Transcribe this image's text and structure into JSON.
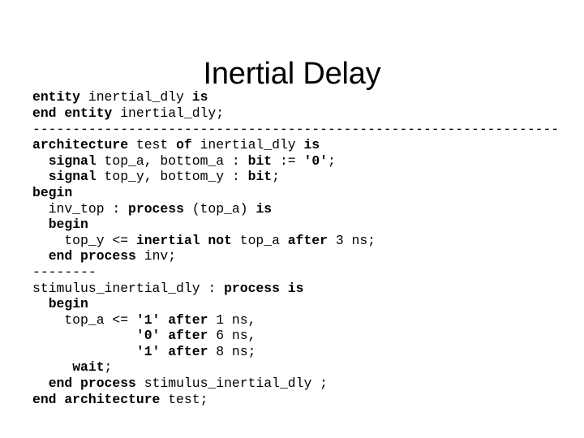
{
  "slide": {
    "title": "Inertial Delay",
    "background_color": "#ffffff",
    "text_color": "#000000"
  },
  "code": {
    "language": "VHDL",
    "lines": [
      [
        {
          "t": "entity ",
          "b": true
        },
        {
          "t": "inertial_dly ",
          "b": false
        },
        {
          "t": "is",
          "b": true
        }
      ],
      [
        {
          "t": "end entity ",
          "b": true
        },
        {
          "t": "inertial_dly;",
          "b": false
        }
      ],
      [
        {
          "t": "------------------------------------------------------------------",
          "b": false
        }
      ],
      [
        {
          "t": "architecture ",
          "b": true
        },
        {
          "t": "test ",
          "b": false
        },
        {
          "t": "of ",
          "b": true
        },
        {
          "t": "inertial_dly ",
          "b": false
        },
        {
          "t": "is",
          "b": true
        }
      ],
      [
        {
          "t": "  ",
          "b": false
        },
        {
          "t": "signal ",
          "b": true
        },
        {
          "t": "top_a, bottom_a : ",
          "b": false
        },
        {
          "t": "bit",
          "b": true
        },
        {
          "t": " := ",
          "b": false
        },
        {
          "t": "'0'",
          "b": true
        },
        {
          "t": ";",
          "b": false
        }
      ],
      [
        {
          "t": "  ",
          "b": false
        },
        {
          "t": "signal ",
          "b": true
        },
        {
          "t": "top_y, bottom_y : ",
          "b": false
        },
        {
          "t": "bit",
          "b": true
        },
        {
          "t": ";",
          "b": false
        }
      ],
      [
        {
          "t": "begin",
          "b": true
        }
      ],
      [
        {
          "t": "  inv_top : ",
          "b": false
        },
        {
          "t": "process ",
          "b": true
        },
        {
          "t": "(top_a) ",
          "b": false
        },
        {
          "t": "is",
          "b": true
        }
      ],
      [
        {
          "t": "  ",
          "b": false
        },
        {
          "t": "begin",
          "b": true
        }
      ],
      [
        {
          "t": "    top_y <= ",
          "b": false
        },
        {
          "t": "inertial not ",
          "b": true
        },
        {
          "t": "top_a ",
          "b": false
        },
        {
          "t": "after ",
          "b": true
        },
        {
          "t": "3 ns;",
          "b": false
        }
      ],
      [
        {
          "t": "  ",
          "b": false
        },
        {
          "t": "end process ",
          "b": true
        },
        {
          "t": "inv;",
          "b": false
        }
      ],
      [
        {
          "t": "--------",
          "b": false
        }
      ],
      [
        {
          "t": "stimulus_inertial_dly : ",
          "b": false
        },
        {
          "t": "process is",
          "b": true
        }
      ],
      [
        {
          "t": "  ",
          "b": false
        },
        {
          "t": "begin",
          "b": true
        }
      ],
      [
        {
          "t": "    top_a <= ",
          "b": false
        },
        {
          "t": "'1' after ",
          "b": true
        },
        {
          "t": "1 ns,",
          "b": false
        }
      ],
      [
        {
          "t": "             ",
          "b": false
        },
        {
          "t": "'0' after ",
          "b": true
        },
        {
          "t": "6 ns,",
          "b": false
        }
      ],
      [
        {
          "t": "             ",
          "b": false
        },
        {
          "t": "'1' after ",
          "b": true
        },
        {
          "t": "8 ns;",
          "b": false
        }
      ],
      [
        {
          "t": "     ",
          "b": false
        },
        {
          "t": "wait",
          "b": true
        },
        {
          "t": ";",
          "b": false
        }
      ],
      [
        {
          "t": "  ",
          "b": false
        },
        {
          "t": "end process ",
          "b": true
        },
        {
          "t": "stimulus_inertial_dly ;",
          "b": false
        }
      ],
      [
        {
          "t": "end architecture ",
          "b": true
        },
        {
          "t": "test;",
          "b": false
        }
      ]
    ]
  }
}
